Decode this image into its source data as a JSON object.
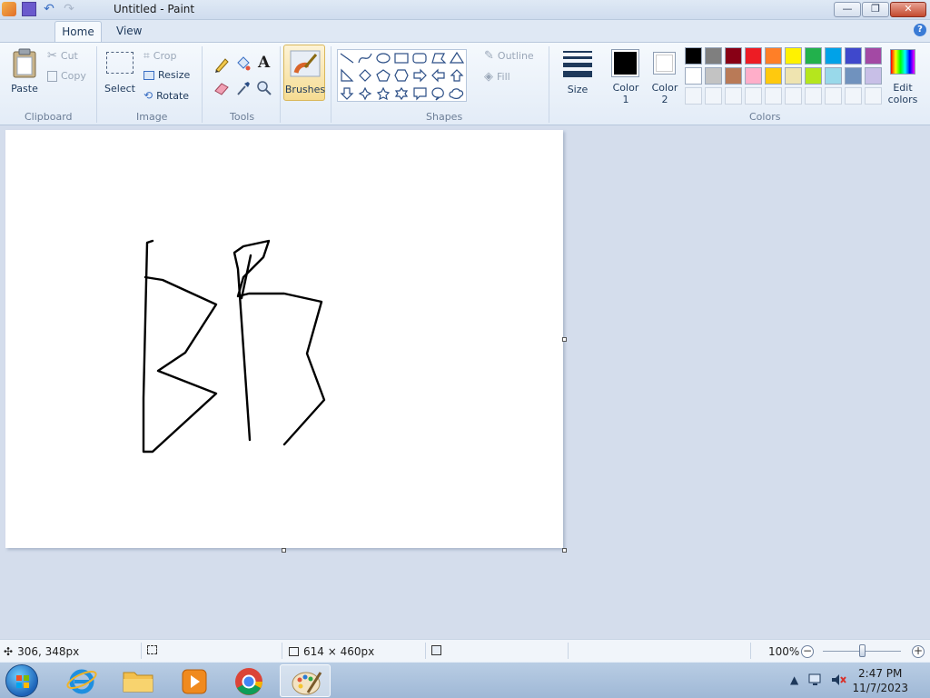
{
  "window": {
    "title": "Untitled - Paint",
    "minimize": "—",
    "maximize": "❐",
    "close": "✕"
  },
  "tabs": {
    "home": "Home",
    "view": "View"
  },
  "ribbon": {
    "clipboard": {
      "label": "Clipboard",
      "paste": "Paste",
      "cut": "Cut",
      "copy": "Copy"
    },
    "image": {
      "label": "Image",
      "select": "Select",
      "crop": "Crop",
      "resize": "Resize",
      "rotate": "Rotate"
    },
    "tools": {
      "label": "Tools"
    },
    "brushes": {
      "label": "Brushes"
    },
    "shapes": {
      "label": "Shapes",
      "outline": "Outline",
      "fill": "Fill"
    },
    "size": {
      "label": "Size"
    },
    "color1": {
      "label_top": "Color",
      "label_bottom": "1",
      "value": "#000000"
    },
    "color2": {
      "label_top": "Color",
      "label_bottom": "2",
      "value": "#ffffff"
    },
    "colors": {
      "label": "Colors",
      "edit_top": "Edit",
      "edit_bottom": "colors",
      "row1": [
        "#000000",
        "#7f7f7f",
        "#880015",
        "#ed1c24",
        "#ff7f27",
        "#fff200",
        "#22b14c",
        "#00a2e8",
        "#3f48cc",
        "#a349a4"
      ],
      "row2": [
        "#ffffff",
        "#c3c3c3",
        "#b97a57",
        "#ffaec9",
        "#ffc90e",
        "#efe4b0",
        "#b5e61d",
        "#99d9ea",
        "#7092be",
        "#c8bfe7"
      ]
    }
  },
  "status": {
    "cursor_pos": "306, 348px",
    "canvas_size": "614 × 460px",
    "zoom": "100%",
    "zoom_level": 100
  },
  "taskbar": {
    "time": "2:47 PM",
    "date": "11/7/2023"
  }
}
